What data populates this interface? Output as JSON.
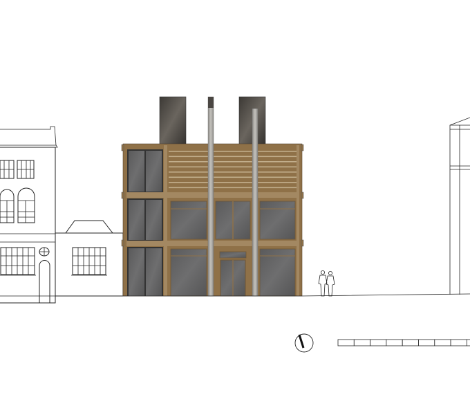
{
  "drawing": {
    "type": "street elevation",
    "colors": {
      "timber": "#8f7148",
      "timber_light": "#b39a72",
      "glazing": "#5f5f60",
      "glazing_frame": "#3a3a3a",
      "chimney": "#4a4642",
      "pipe": "#a9a7a2",
      "linework": "#222222"
    },
    "scale_bar_segments": 9,
    "people_count": 2
  }
}
